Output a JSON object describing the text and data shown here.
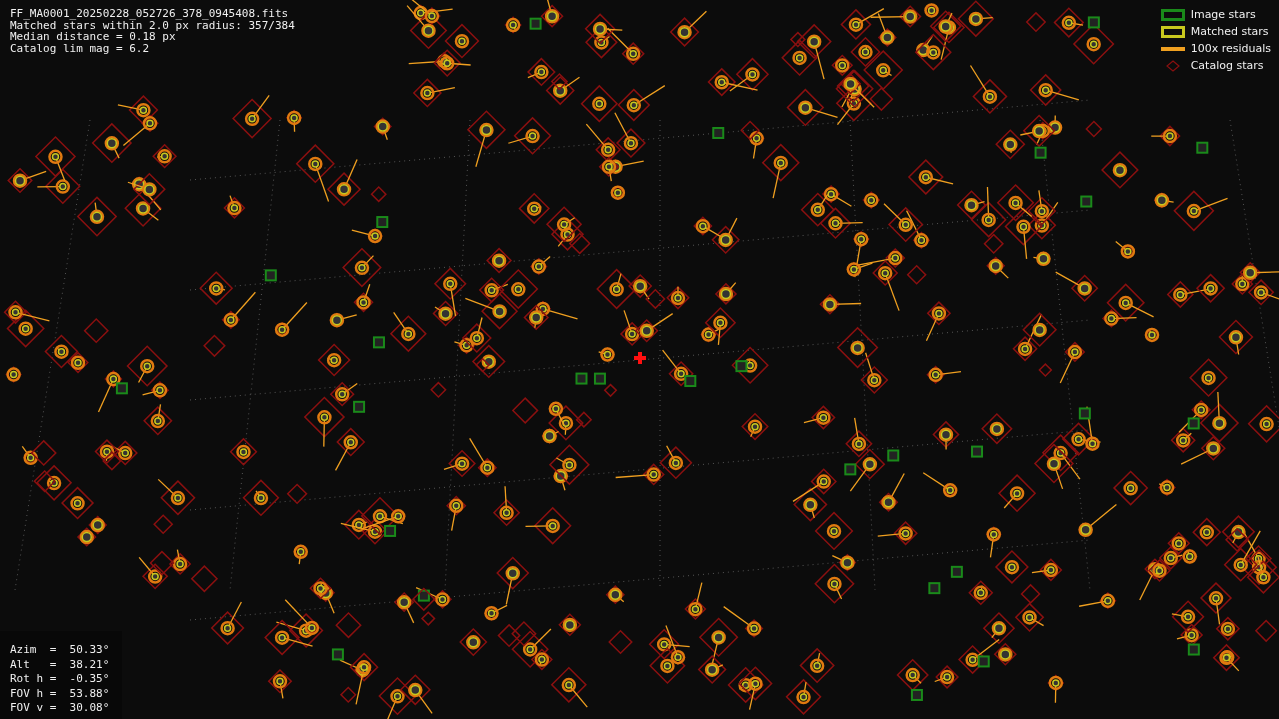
{
  "info": [
    "FF_MA0001_20250228_052726_378_0945408.fits",
    "Matched stars within 2.0 px radius: 357/384",
    "Median distance = 0.18 px",
    "Catalog lim mag = 6.2"
  ],
  "legend": [
    {
      "label": "Image stars",
      "kind": "box",
      "color": "#1a8a1a"
    },
    {
      "label": "Matched stars",
      "kind": "box",
      "color": "#c8c81e"
    },
    {
      "label": "100x residuals",
      "kind": "line",
      "color": "#f0a020"
    },
    {
      "label": "Catalog stars",
      "kind": "diamond",
      "color": "#8a1010"
    }
  ],
  "readout": [
    "Azim  =  50.33°",
    "Alt   =  38.21°",
    "Rot h =  -0.35°",
    "FOV h =  53.88°",
    "FOV v =  30.08°"
  ]
}
